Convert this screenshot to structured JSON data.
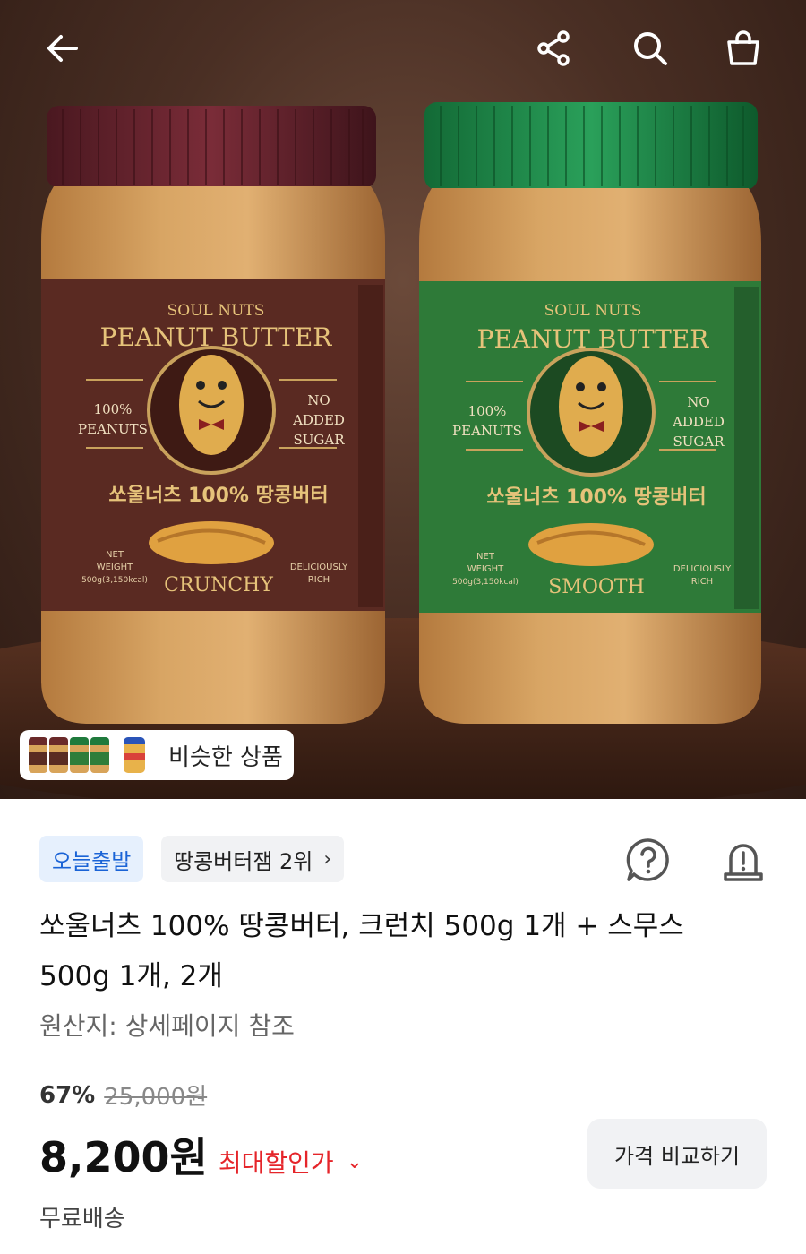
{
  "header": {
    "icons": [
      "back-arrow-icon",
      "share-icon",
      "search-icon",
      "cart-icon"
    ]
  },
  "hero": {
    "jar_left": {
      "brand": "SOUL NUTS",
      "product": "PEANUT BUTTER",
      "claim_left": [
        "100%",
        "PEANUTS"
      ],
      "claim_right": [
        "NO",
        "ADDED",
        "SUGAR"
      ],
      "korean_name": "쏘울너츠 100% 땅콩버터",
      "variant": "CRUNCHY",
      "net_weight": [
        "NET",
        "WEIGHT",
        "500g(3,150kcal)"
      ],
      "tagline": [
        "DELICIOUSLY",
        "RICH"
      ],
      "cap_color": "#6b2330",
      "label_color": "#5a2a22"
    },
    "jar_right": {
      "brand": "SOUL NUTS",
      "product": "PEANUT BUTTER",
      "claim_left": [
        "100%",
        "PEANUTS"
      ],
      "claim_right": [
        "NO",
        "ADDED",
        "SUGAR"
      ],
      "korean_name": "쏘울너츠 100% 땅콩버터",
      "variant": "SMOOTH",
      "net_weight": [
        "NET",
        "WEIGHT",
        "500g(3,150kcal)"
      ],
      "tagline": [
        "DELICIOUSLY",
        "RICH"
      ],
      "cap_color": "#1f8a4a",
      "label_color": "#2e7a38"
    },
    "similar_label": "비슷한 상품"
  },
  "product": {
    "badges": {
      "today": "오늘출발",
      "rank": "땅콩버터잼 2위"
    },
    "title_line1": "쏘울너츠 100% 땅콩버터, 크런치 500g 1개 + 스무스",
    "title_line2": "500g 1개, 2개",
    "origin": "원산지: 상세페이지 참조",
    "discount_pct": "67%",
    "original_price": "25,000원",
    "price": "8,200원",
    "max_discount_label": "최대할인가",
    "compare_label": "가격 비교하기",
    "shipping": "무료배송",
    "accent_color": "#e5252a",
    "badge_blue": "#1a63d6"
  }
}
